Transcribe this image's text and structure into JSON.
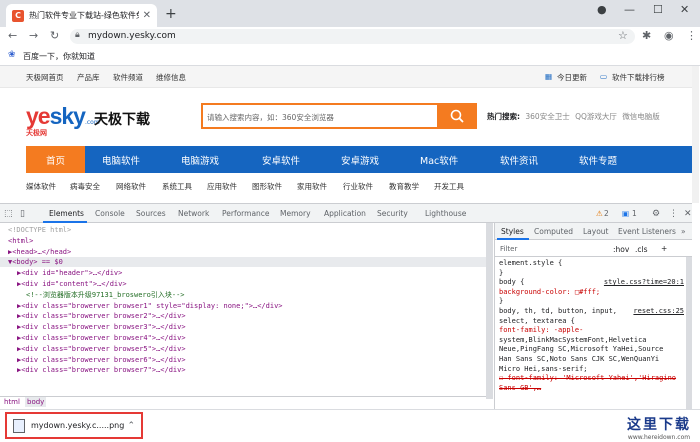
{
  "browser": {
    "tab_title": "热门软件专业下载站-绿色软件免",
    "favicon_letter": "C",
    "url": "mydown.yesky.com",
    "new_tab": "+",
    "bookmarks": [
      {
        "label": "百度一下，你就知道"
      }
    ]
  },
  "site": {
    "top_links": [
      "天极网首页",
      "产品库",
      "软件频道",
      "维修信息"
    ],
    "top_right": [
      "今日更新",
      "软件下载排行榜"
    ],
    "logo": {
      "brand_y": "y",
      "brand_e": "e",
      "brand_sky": "sky",
      "com": ".com",
      "sub": "天极网",
      "name": "天极下载"
    },
    "search_placeholder": "请输入搜索内容，如：360安全浏览器",
    "hot_label": "热门搜索:",
    "hot_items": [
      "360安全卫士",
      "QQ游戏大厅",
      "微信电脑版"
    ],
    "nav": [
      "首页",
      "电脑软件",
      "电脑游戏",
      "安卓软件",
      "安卓游戏",
      "Mac软件",
      "软件资讯",
      "软件专题"
    ],
    "sub_nav": [
      "媒体软件",
      "病毒安全",
      "网络软件",
      "系统工具",
      "应用软件",
      "图形软件",
      "家用软件",
      "行业软件",
      "教育教学",
      "开发工具"
    ]
  },
  "devtools": {
    "tabs": [
      "Elements",
      "Console",
      "Sources",
      "Network",
      "Performance",
      "Memory",
      "Application",
      "Security",
      "Lighthouse"
    ],
    "badge_warn": "2",
    "badge_info": "1",
    "dom_lines": [
      {
        "indent": 0,
        "t": "<!DOCTYPE html>",
        "cls": "gray"
      },
      {
        "indent": 0,
        "t": "<html>",
        "cls": "tag"
      },
      {
        "indent": 0,
        "t": "▶<head>…</head>",
        "cls": "tag"
      },
      {
        "indent": 0,
        "t": "▼<body> == $0",
        "cls": "tag",
        "sel": true
      },
      {
        "indent": 1,
        "t": "▶<div id=\"header\">…</div>",
        "cls": "tag"
      },
      {
        "indent": 1,
        "t": "▶<div id=\"content\">…</div>",
        "cls": "tag"
      },
      {
        "indent": 2,
        "t": "<!--浏览器版本升级97131_broswero引入块-->",
        "cls": "cmt"
      },
      {
        "indent": 1,
        "t": "▶<div class=\"browerver browser1\" style=\"display: none;\">…</div>",
        "cls": "tag"
      },
      {
        "indent": 1,
        "t": "▶<div class=\"browerver browser2\">…</div>",
        "cls": "tag"
      },
      {
        "indent": 1,
        "t": "▶<div class=\"browerver browser3\">…</div>",
        "cls": "tag"
      },
      {
        "indent": 1,
        "t": "▶<div class=\"browerver browser4\">…</div>",
        "cls": "tag"
      },
      {
        "indent": 1,
        "t": "▶<div class=\"browerver browser5\">…</div>",
        "cls": "tag"
      },
      {
        "indent": 1,
        "t": "▶<div class=\"browerver browser6\">…</div>",
        "cls": "tag"
      },
      {
        "indent": 1,
        "t": "▶<div class=\"browerver browser7\">…</div>",
        "cls": "tag"
      }
    ],
    "breadcrumbs": [
      "html",
      "body"
    ],
    "style_tabs": [
      "Styles",
      "Computed",
      "Layout",
      "Event Listeners"
    ],
    "filter_placeholder": "Filter",
    "filter_tools": [
      ":hov",
      ".cls",
      "+"
    ],
    "style_lines": [
      {
        "t": "element.style {",
        "k": "plain"
      },
      {
        "t": "}",
        "k": "plain"
      },
      {
        "t": "body {",
        "k": "plain",
        "src": "style.css?time=20:1"
      },
      {
        "t": "  background-color: □#fff;",
        "k": "prop"
      },
      {
        "t": "}",
        "k": "plain"
      },
      {
        "t": "body, th, td, button, input,",
        "k": "plain",
        "src": "reset.css:25"
      },
      {
        "t": "select, textarea {",
        "k": "plain"
      },
      {
        "t": "  font-family: -apple-",
        "k": "prop"
      },
      {
        "t": "    system,BlinkMacSystemFont,Helvetica",
        "k": "plain"
      },
      {
        "t": "    Neue,PingFang SC,Microsoft YaHei,Source",
        "k": "plain"
      },
      {
        "t": "    Han Sans SC,Noto Sans CJK SC,WenQuanYi",
        "k": "plain"
      },
      {
        "t": "    Micro Hei,sans-serif;",
        "k": "plain"
      },
      {
        "t": "☐ font-family: 'Microsoft Yahei','Hiragino",
        "k": "strike"
      },
      {
        "t": "    Sans GB',…",
        "k": "strike"
      }
    ]
  },
  "download": {
    "filename": "mydown.yesky.c.....png"
  },
  "watermark": {
    "big": "这里下载",
    "small": "www.hereidown.com"
  }
}
